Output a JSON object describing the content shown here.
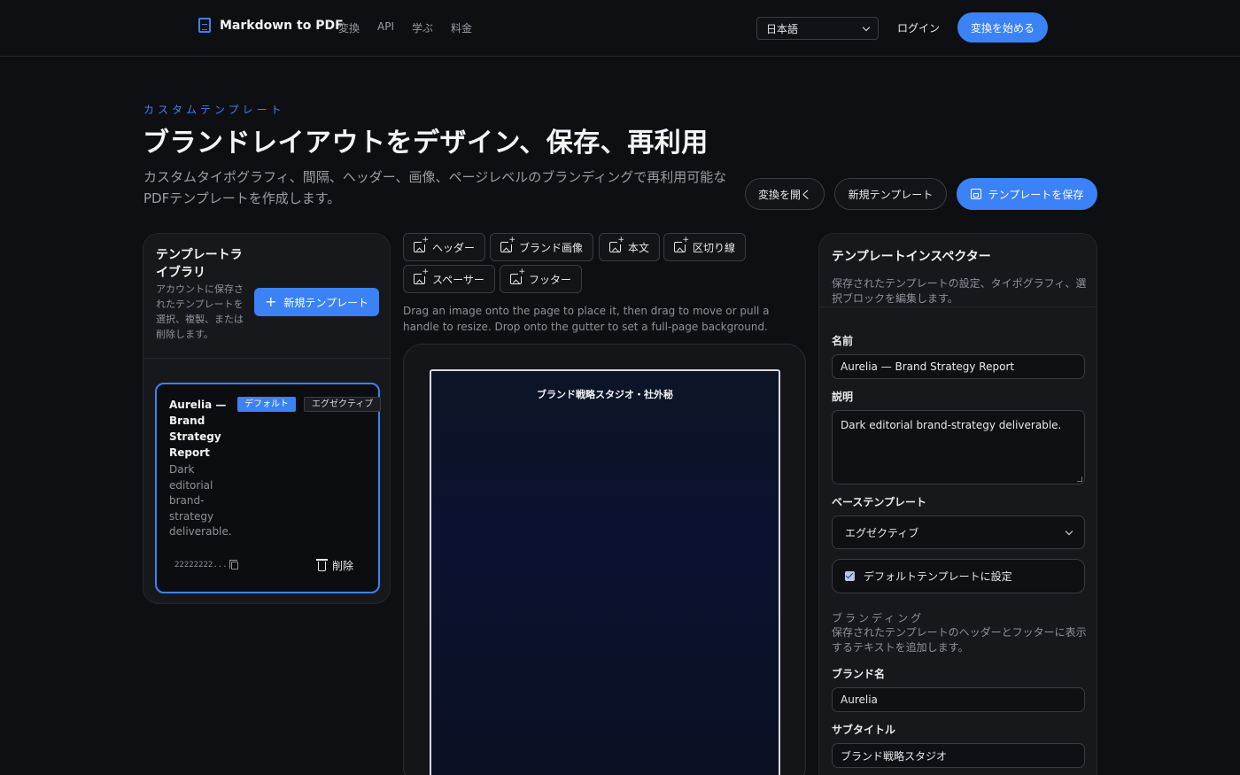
{
  "header": {
    "brand": "Markdown to PDF",
    "nav": [
      "変換",
      "API",
      "学ぶ",
      "料金"
    ],
    "language": "日本語",
    "login": "ログイン",
    "start": "変換を始める"
  },
  "hero": {
    "eyebrow": "カスタムテンプレート",
    "title": "ブランドレイアウトをデザイン、保存、再利用",
    "description": "カスタムタイポグラフィ、間隔、ヘッダー、画像、ページレベルのブランディングで再利用可能なPDFテンプレートを作成します。",
    "open_converter": "変換を開く",
    "new_template": "新規テンプレート",
    "save_template": "テンプレートを保存"
  },
  "library": {
    "title": "テンプレートライブラリ",
    "description": "アカウントに保存されたテンプレートを選択、複製、または削除します。",
    "new_button": "新規テンプレート",
    "templates": [
      {
        "name": "Aurelia — Brand Strategy Report",
        "description": "Dark editorial brand-strategy deliverable.",
        "badge_default": "デフォルト",
        "badge_base": "エグゼクティブ",
        "id": "22222222...",
        "delete": "削除"
      }
    ]
  },
  "blocks": [
    "ヘッダー",
    "ブランド画像",
    "本文",
    "区切り線",
    "スペーサー",
    "フッター"
  ],
  "editor": {
    "hint": "Drag an image onto the page to place it, then drag to move or pull a handle to resize. Drop onto the gutter to set a full-page background.",
    "page_header": "ブランド戦略スタジオ・社外秘"
  },
  "inspector": {
    "title": "テンプレートインスペクター",
    "description": "保存されたテンプレートの設定、タイポグラフィ、選択ブロックを編集します。",
    "name_label": "名前",
    "name_value": "Aurelia — Brand Strategy Report",
    "desc_label": "説明",
    "desc_value": "Dark editorial brand-strategy deliverable.",
    "base_label": "ベーステンプレート",
    "base_value": "エグゼクティブ",
    "default_check": "デフォルトテンプレートに設定",
    "default_checked": true,
    "branding_title": "ブランディング",
    "branding_desc": "保存されたテンプレートのヘッダーとフッターに表示するテキストを追加します。",
    "brand_name_label": "ブランド名",
    "brand_name_value": "Aurelia",
    "subtitle_label": "サブタイトル",
    "subtitle_value": "ブランド戦略スタジオ"
  },
  "colors": {
    "accent": "#3b82f6",
    "background": "#0e0f12",
    "panel": "#17181c"
  }
}
